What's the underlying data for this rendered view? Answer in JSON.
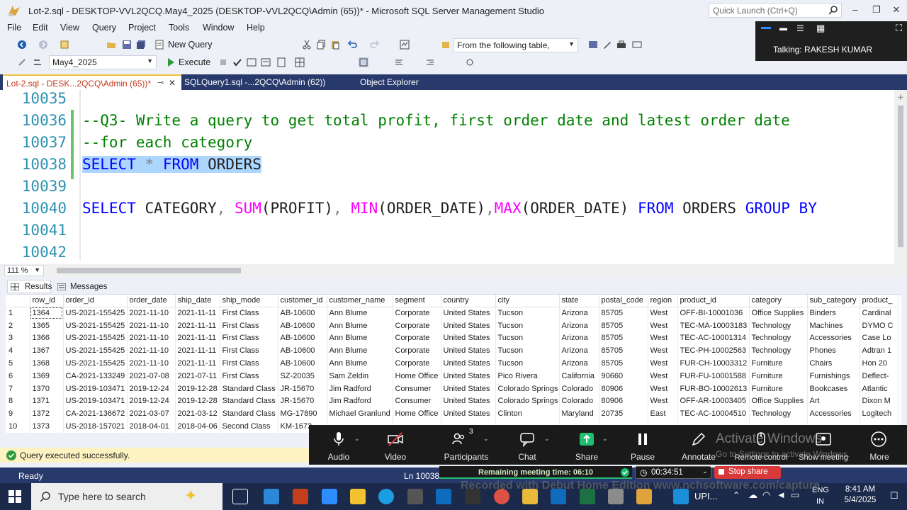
{
  "window": {
    "title": "Lot-2.sql - DESKTOP-VVL2QCQ.May4_2025 (DESKTOP-VVL2QCQ\\Admin (65))* - Microsoft SQL Server Management Studio",
    "quick_launch_placeholder": "Quick Launch (Ctrl+Q)"
  },
  "menu": [
    "File",
    "Edit",
    "View",
    "Query",
    "Project",
    "Tools",
    "Window",
    "Help"
  ],
  "toolbar": {
    "new_query": "New Query",
    "find_combo": "From the following table,",
    "database_combo": "May4_2025",
    "execute": "Execute"
  },
  "zoom_talking": "Talking: RAKESH KUMAR",
  "tabs": {
    "active": "Lot-2.sql - DESK...2QCQ\\Admin (65))*",
    "second": "SQLQuery1.sql -...2QCQ\\Admin (62))",
    "third": "Object Explorer"
  },
  "editor": {
    "lines": [
      "10035",
      "10036",
      "10037",
      "10038",
      "10039",
      "10040",
      "10041",
      "10042"
    ],
    "comment1": "--Q3- Write a query to get total profit, first order date and latest order date",
    "comment2": "--for each category",
    "select_all": [
      "SELECT",
      " ",
      "*",
      " ",
      "FROM",
      " ",
      "ORDERS"
    ],
    "query": {
      "select": "SELECT",
      "category": " CATEGORY",
      "comma1": ", ",
      "sum": "SUM",
      "profit": "(PROFIT)",
      "comma2": ", ",
      "min": "MIN",
      "min_arg": "(ORDER_DATE)",
      "comma3": ",",
      "max": "MAX",
      "max_arg": "(ORDER_DATE)",
      "from": " FROM",
      "orders": " ORDERS",
      "groupby": " GROUP BY"
    }
  },
  "zoom_level": "111 %",
  "result_tabs": {
    "results": "Results",
    "messages": "Messages"
  },
  "results": {
    "columns": [
      "row_id",
      "order_id",
      "order_date",
      "ship_date",
      "ship_mode",
      "customer_id",
      "customer_name",
      "segment",
      "country",
      "city",
      "state",
      "postal_code",
      "region",
      "product_id",
      "category",
      "sub_category",
      "product_"
    ],
    "rows": [
      [
        "1",
        "1364",
        "US-2021-155425",
        "2021-11-10",
        "2021-11-11",
        "First Class",
        "AB-10600",
        "Ann Blume",
        "Corporate",
        "United States",
        "Tucson",
        "Arizona",
        "85705",
        "West",
        "OFF-BI-10001036",
        "Office Supplies",
        "Binders",
        "Cardinal"
      ],
      [
        "2",
        "1365",
        "US-2021-155425",
        "2021-11-10",
        "2021-11-11",
        "First Class",
        "AB-10600",
        "Ann Blume",
        "Corporate",
        "United States",
        "Tucson",
        "Arizona",
        "85705",
        "West",
        "TEC-MA-10003183",
        "Technology",
        "Machines",
        "DYMO C"
      ],
      [
        "3",
        "1366",
        "US-2021-155425",
        "2021-11-10",
        "2021-11-11",
        "First Class",
        "AB-10600",
        "Ann Blume",
        "Corporate",
        "United States",
        "Tucson",
        "Arizona",
        "85705",
        "West",
        "TEC-AC-10001314",
        "Technology",
        "Accessories",
        "Case Lo"
      ],
      [
        "4",
        "1367",
        "US-2021-155425",
        "2021-11-10",
        "2021-11-11",
        "First Class",
        "AB-10600",
        "Ann Blume",
        "Corporate",
        "United States",
        "Tucson",
        "Arizona",
        "85705",
        "West",
        "TEC-PH-10002563",
        "Technology",
        "Phones",
        "Adtran 1"
      ],
      [
        "5",
        "1368",
        "US-2021-155425",
        "2021-11-10",
        "2021-11-11",
        "First Class",
        "AB-10600",
        "Ann Blume",
        "Corporate",
        "United States",
        "Tucson",
        "Arizona",
        "85705",
        "West",
        "FUR-CH-10003312",
        "Furniture",
        "Chairs",
        "Hon 20"
      ],
      [
        "6",
        "1369",
        "CA-2021-133249",
        "2021-07-08",
        "2021-07-11",
        "First Class",
        "SZ-20035",
        "Sam Zeldin",
        "Home Office",
        "United States",
        "Pico Rivera",
        "California",
        "90660",
        "West",
        "FUR-FU-10001588",
        "Furniture",
        "Furnishings",
        "Deflect-"
      ],
      [
        "7",
        "1370",
        "US-2019-103471",
        "2019-12-24",
        "2019-12-28",
        "Standard Class",
        "JR-15670",
        "Jim Radford",
        "Consumer",
        "United States",
        "Colorado Springs",
        "Colorado",
        "80906",
        "West",
        "FUR-BO-10002613",
        "Furniture",
        "Bookcases",
        "Atlantic"
      ],
      [
        "8",
        "1371",
        "US-2019-103471",
        "2019-12-24",
        "2019-12-28",
        "Standard Class",
        "JR-15670",
        "Jim Radford",
        "Consumer",
        "United States",
        "Colorado Springs",
        "Colorado",
        "80906",
        "West",
        "OFF-AR-10003405",
        "Office Supplies",
        "Art",
        "Dixon M"
      ],
      [
        "9",
        "1372",
        "CA-2021-136672",
        "2021-03-07",
        "2021-03-12",
        "Standard Class",
        "MG-17890",
        "Michael Granlund",
        "Home Office",
        "United States",
        "Clinton",
        "Maryland",
        "20735",
        "East",
        "TEC-AC-10004510",
        "Technology",
        "Accessories",
        "Logitech"
      ],
      [
        "10",
        "1373",
        "US-2018-157021",
        "2018-04-01",
        "2018-04-06",
        "Second Class",
        "KM-1672",
        "",
        "",
        "",
        "",
        "",
        "",
        "",
        "",
        "",
        "",
        ""
      ]
    ]
  },
  "status": {
    "query_message": "Query executed successfully.",
    "ready": "Ready",
    "ln": "Ln 10038"
  },
  "zoom_controls": {
    "audio": "Audio",
    "video": "Video",
    "participants": "Participants",
    "participants_count": "3",
    "chat": "Chat",
    "share": "Share",
    "pause": "Pause",
    "annotate": "Annotate",
    "remote_control": "Remote control",
    "show_meeting": "Show meeting",
    "more": "More",
    "activate_windows": "Activate Windows",
    "activate_sub": "Go to Settings to activate Windows.",
    "remaining": "Remaining meeting time: 06:10",
    "timer": "00:34:51",
    "stop_share": "Stop share",
    "recorded": "Recorded with Debut Home Edition www.nchsoftware.com/capture"
  },
  "taskbar": {
    "search_placeholder": "Type here to search",
    "upi": "UPI...",
    "lang": "ENG",
    "region": "IN",
    "time": "8:41 AM",
    "date": "5/4/2025"
  },
  "colors": {
    "tab_strip": "#283a6b",
    "keyword": "#0000ff",
    "comment": "#008000",
    "function": "#ff00ff",
    "line_number": "#2b91af",
    "selection": "#add6ff"
  }
}
